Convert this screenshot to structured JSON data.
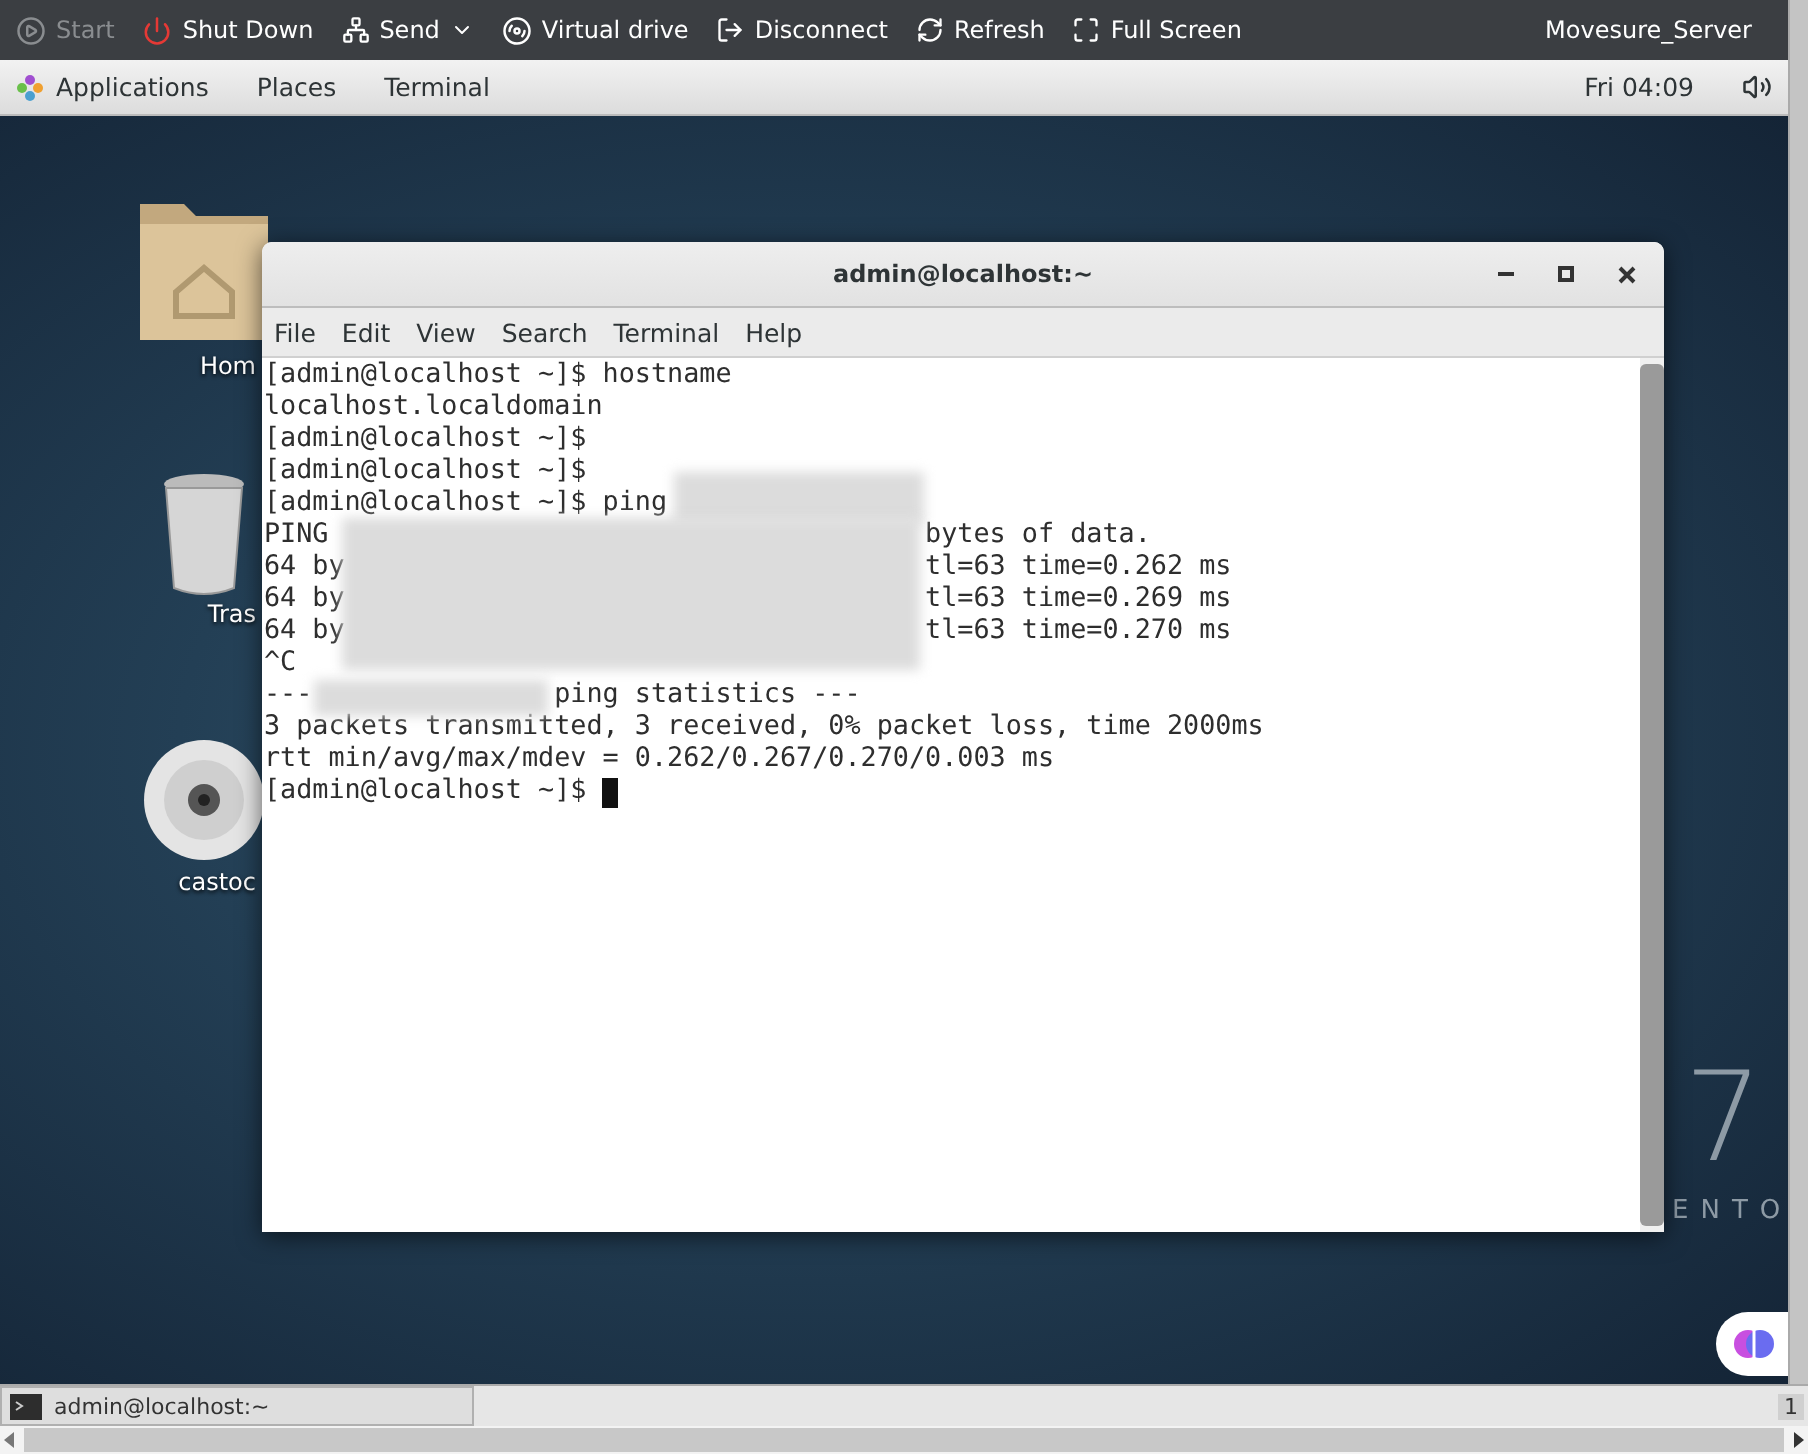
{
  "toolbar": {
    "items": [
      {
        "label": "Start",
        "kind": "start",
        "disabled": true
      },
      {
        "label": "Shut Down",
        "kind": "power",
        "disabled": false
      },
      {
        "label": "Send",
        "kind": "send",
        "disabled": false
      },
      {
        "label": "Virtual drive",
        "kind": "drive",
        "disabled": false
      },
      {
        "label": "Disconnect",
        "kind": "disconnect",
        "disabled": false
      },
      {
        "label": "Refresh",
        "kind": "refresh",
        "disabled": false
      },
      {
        "label": "Full Screen",
        "kind": "fullscreen",
        "disabled": false
      }
    ],
    "server": "Movesure_Server"
  },
  "topbar": {
    "menus": [
      "Applications",
      "Places",
      "Terminal"
    ],
    "clock": "Fri 04:09"
  },
  "desktop": {
    "icons": [
      {
        "label": "Hom",
        "kind": "folder"
      },
      {
        "label": "Tras",
        "kind": "trash"
      },
      {
        "label": "castoc",
        "kind": "disc"
      }
    ],
    "logo": {
      "numeral": "7",
      "word": "ENTO"
    }
  },
  "terminal": {
    "title": "admin@localhost:~",
    "menu": [
      "File",
      "Edit",
      "View",
      "Search",
      "Terminal",
      "Help"
    ],
    "lines": [
      {
        "kind": "plain",
        "text": "[admin@localhost ~]$ hostname"
      },
      {
        "kind": "plain",
        "text": "localhost.localdomain"
      },
      {
        "kind": "plain",
        "text": "[admin@localhost ~]$"
      },
      {
        "kind": "plain",
        "text": "[admin@localhost ~]$"
      },
      {
        "kind": "plain",
        "text": "[admin@localhost ~]$ ping"
      },
      {
        "kind": "gap_long",
        "text": "PING",
        "tail": "bytes of data."
      },
      {
        "kind": "gap_long",
        "text": "64 by",
        "tail": "tl=63 time=0.262 ms"
      },
      {
        "kind": "gap_long",
        "text": "64 by",
        "tail": "tl=63 time=0.269 ms"
      },
      {
        "kind": "gap_long",
        "text": "64 by",
        "tail": "tl=63 time=0.270 ms"
      },
      {
        "kind": "plain",
        "text": "^C"
      },
      {
        "kind": "gap_short",
        "text": "---",
        "tail": "ping statistics ---"
      },
      {
        "kind": "plain",
        "text": "3 packets transmitted, 3 received, 0% packet loss, time 2000ms"
      },
      {
        "kind": "plain",
        "text": "rtt min/avg/max/mdev = 0.262/0.267/0.270/0.003 ms"
      },
      {
        "kind": "cursor",
        "text": "[admin@localhost ~]$"
      }
    ]
  },
  "taskbar": {
    "items": [
      "admin@localhost:~"
    ],
    "workspace": "1"
  }
}
